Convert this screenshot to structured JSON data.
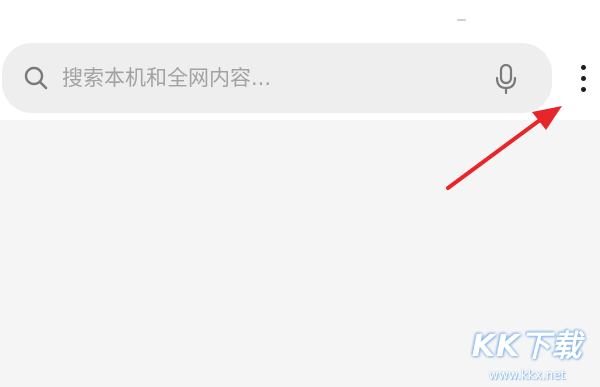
{
  "search": {
    "placeholder": "搜索本机和全网内容..."
  },
  "icons": {
    "search": "search-icon",
    "mic": "microphone-icon",
    "more": "more-vertical-icon",
    "arrow": "red-arrow-annotation"
  },
  "colors": {
    "arrow": "#e8262a",
    "search_bar_bg": "#eeeeee",
    "content_bg": "#f5f5f5"
  },
  "watermark": {
    "logo_text": "KK下载",
    "url": "www.kkx.net"
  }
}
